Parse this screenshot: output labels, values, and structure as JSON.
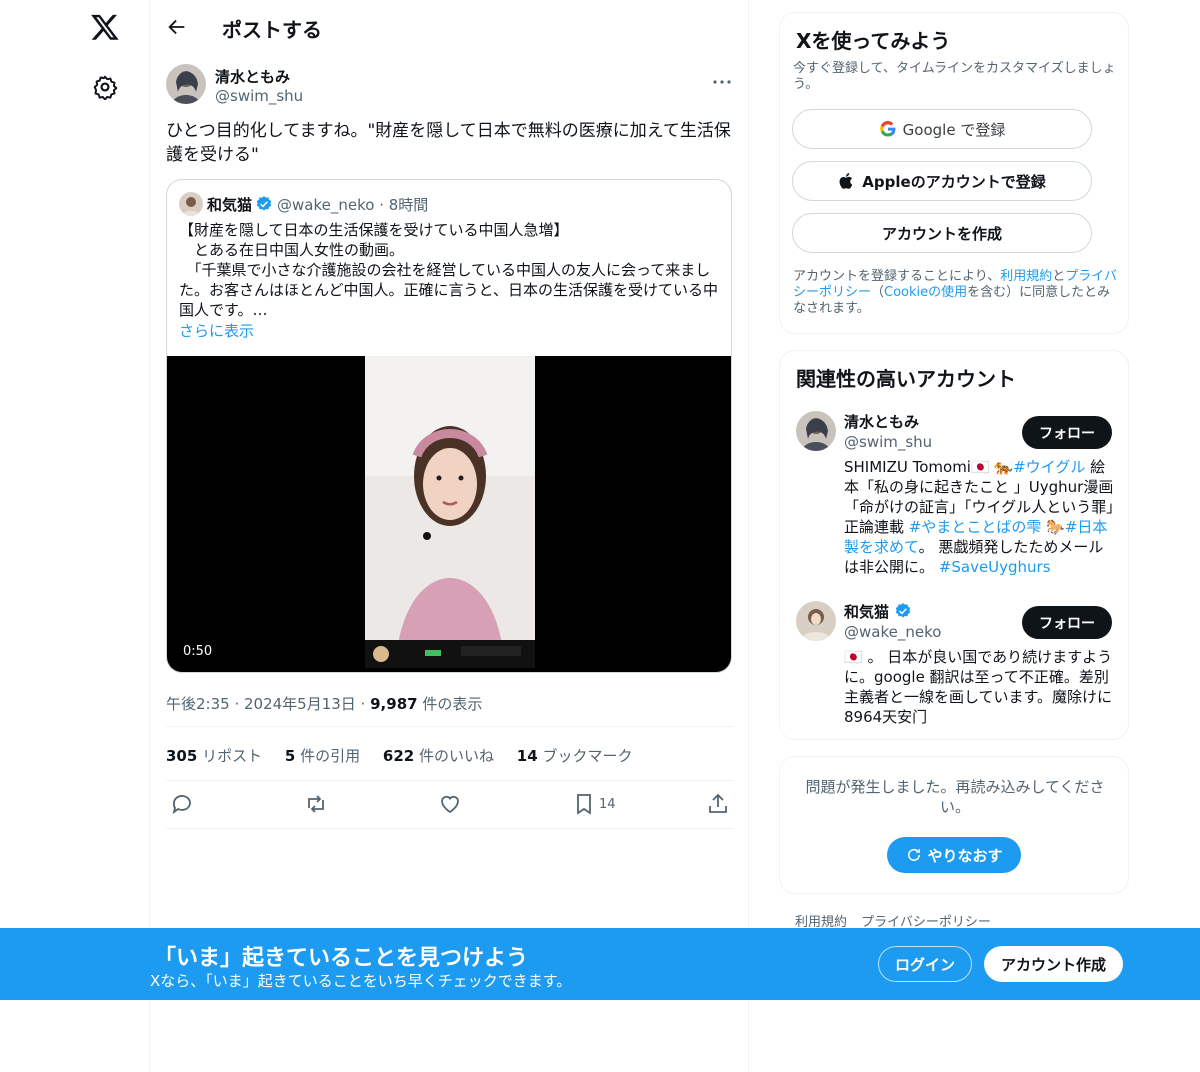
{
  "nav": {
    "logo_icon": "x-logo-icon",
    "settings_icon": "gear-icon"
  },
  "header": {
    "title": "ポストする",
    "back_icon": "arrow-left-icon"
  },
  "tweet": {
    "author_name": "清水ともみ",
    "author_handle": "@swim_shu",
    "text": "ひとつ目的化してますね。\"財産を隠して日本で無料の医療に加えて生活保護を受ける\"",
    "quote": {
      "name": "和気猫",
      "handle": "@wake_neko",
      "time": "· 8時間",
      "text": "【財産を隠して日本の生活保護を受けている中国人急増】\n　とある在日中国人女性の動画。\n　「千葉県で小さな介護施設の会社を経営している中国人の友人に会って来ました。お客さんはほとんど中国人。正確に言うと、日本の生活保護を受けている中国人です。…",
      "show_more": "さらに表示",
      "video_duration": "0:50"
    },
    "timestamp": "午後2:35 · 2024年5月13日 ·",
    "views_count": "9,987",
    "views_label": "件の表示",
    "stats": [
      {
        "count": "305",
        "label": "リポスト"
      },
      {
        "count": "5",
        "label": "件の引用"
      },
      {
        "count": "622",
        "label": "件のいいね"
      },
      {
        "count": "14",
        "label": "ブックマーク"
      }
    ],
    "bookmark_count": "14"
  },
  "signup": {
    "title": "Xを使ってみよう",
    "subtitle": "今すぐ登録して、タイムラインをカスタマイズしましょう。",
    "google_label": "Google で登録",
    "apple_label": "Appleのアカウントで登録",
    "create_label": "アカウントを作成",
    "legal_1": "アカウントを登録することにより、",
    "legal_terms": "利用規約",
    "legal_2": "と",
    "legal_privacy": "プライバシーポリシー",
    "legal_3": "（",
    "legal_cookie": "Cookieの使用",
    "legal_4": "を含む）に同意したとみなされます。"
  },
  "related": {
    "title": "関連性の高いアカウント",
    "follow_label": "フォロー",
    "accounts": [
      {
        "name": "清水ともみ",
        "handle": "@swim_shu",
        "bio_1": "SHIMIZU Tomomi🇯🇵 🐅",
        "bio_tag1": "#ウイグル",
        "bio_2": " 絵本「私の身に起きたこと 」Uyghur漫画「命がけの証言」「ウイグル人という罪」正論連載 ",
        "bio_tag2": "#やまとことばの雫",
        "bio_3": " 🐎",
        "bio_tag3": "#日本製を求めて",
        "bio_4": "。 悪戯頻発したためメールは非公開に。 ",
        "bio_tag4": "#SaveUyghurs"
      },
      {
        "name": "和気猫",
        "handle": "@wake_neko",
        "bio": "🇯🇵 。 日本が良い国であり続けますように。google 翻訳は至って不正確。差別主義者と一線を画しています。魔除けに8964天安门"
      }
    ]
  },
  "error": {
    "text": "問題が発生しました。再読み込みしてください。",
    "retry_label": "やりなおす"
  },
  "footer": {
    "terms": "利用規約",
    "privacy": "プライバシーポリシー"
  },
  "banner": {
    "title": "「いま」起きていることを見つけよう",
    "subtitle": "Xなら、「いま」起きていることをいち早くチェックできます。",
    "login_label": "ログイン",
    "signup_label": "アカウント作成"
  },
  "colors": {
    "accent": "#1d9bf0",
    "text": "#0f1419",
    "muted": "#536471",
    "border": "#eff3f4"
  }
}
